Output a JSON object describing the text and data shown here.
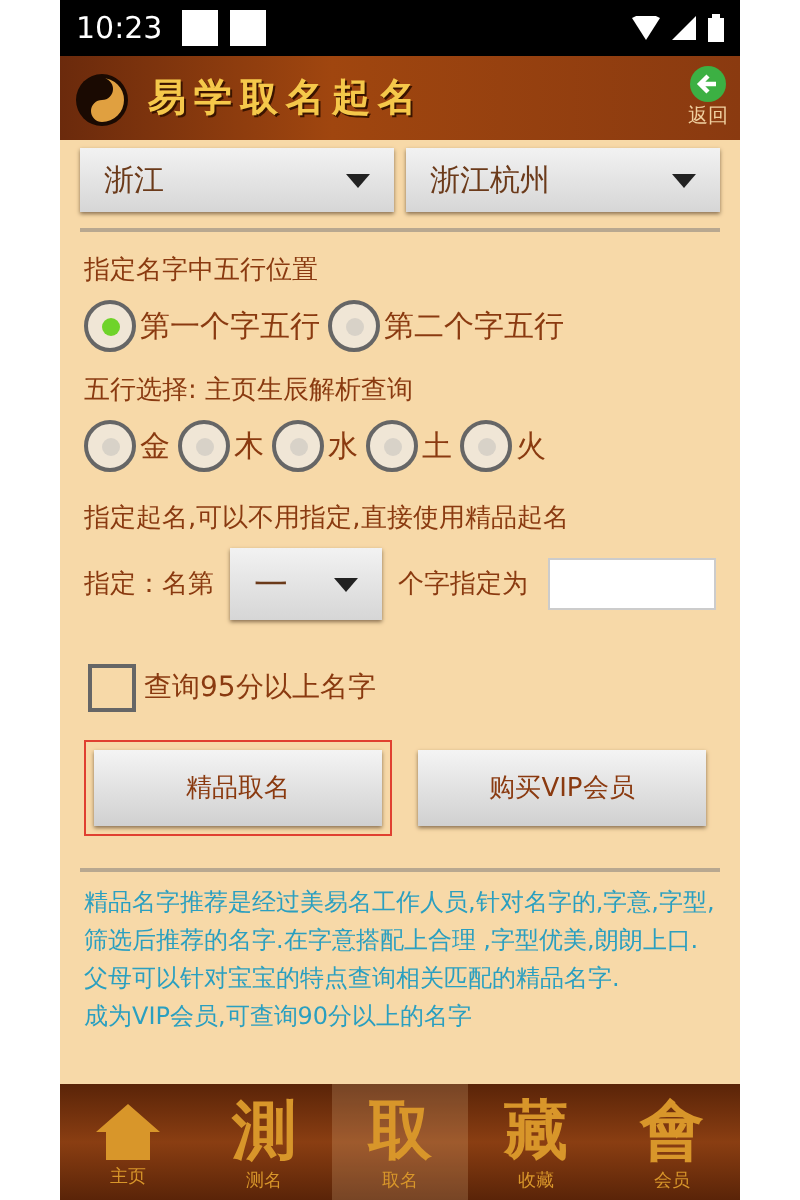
{
  "status_bar": {
    "time": "10:23"
  },
  "header": {
    "title": "易学取名起名",
    "back_label": "返回"
  },
  "region": {
    "province": "浙江",
    "city": "浙江杭州"
  },
  "position": {
    "label": "指定名字中五行位置",
    "options": [
      {
        "label": "第一个字五行",
        "selected": true
      },
      {
        "label": "第二个字五行",
        "selected": false
      }
    ]
  },
  "wuxing": {
    "label": "五行选择: 主页生辰解析查询",
    "options": [
      {
        "label": "金",
        "selected": false
      },
      {
        "label": "木",
        "selected": false
      },
      {
        "label": "水",
        "selected": false
      },
      {
        "label": "土",
        "selected": false
      },
      {
        "label": "火",
        "selected": false
      }
    ]
  },
  "assign": {
    "title": "指定起名,可以不用指定,直接使用精品起名",
    "prefix": "指定：名第",
    "index_value": "一",
    "suffix": "个字指定为"
  },
  "score_filter": {
    "label": "查询95分以上名字",
    "checked": false
  },
  "buttons": [
    {
      "label": "精品取名",
      "highlighted": true
    },
    {
      "label": "购买VIP会员",
      "highlighted": false
    }
  ],
  "info": [
    "精品名字推荐是经过美易名工作人员,针对名字的,字意,字型,筛选后推荐的名字.在字意搭配上合理 ,字型优美,朗朗上口.",
    "父母可以针对宝宝的特点查询相关匹配的精品名字.",
    "成为VIP会员,可查询90分以上的名字"
  ],
  "nav": [
    {
      "kind": "house",
      "label": "主页",
      "selected": false
    },
    {
      "kind": "glyph",
      "glyph": "測",
      "label": "测名",
      "selected": false
    },
    {
      "kind": "glyph",
      "glyph": "取",
      "label": "取名",
      "selected": true
    },
    {
      "kind": "glyph",
      "glyph": "藏",
      "label": "收藏",
      "selected": false
    },
    {
      "kind": "glyph",
      "glyph": "會",
      "label": "会员",
      "selected": false
    }
  ]
}
